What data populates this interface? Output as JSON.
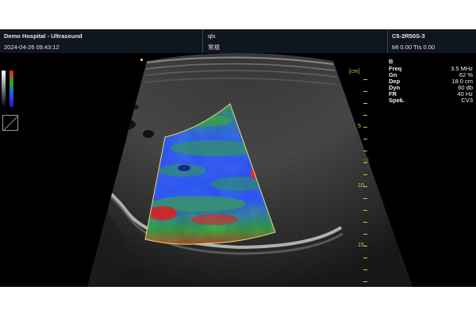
{
  "header": {
    "title": "Demo Hospital - Ultrasound",
    "datetime": "2024-04-26 09:43:12",
    "patient_id": "qlx",
    "patient_name": "常规",
    "probe": "C5-2R50S-3",
    "indices": "MI 0.00 TIs 0.00"
  },
  "params": {
    "mode": "B",
    "rows": [
      {
        "label": "Freq",
        "value": "3.5 MHz"
      },
      {
        "label": "Gn",
        "value": "62 %"
      },
      {
        "label": "Dep",
        "value": "18.0 cm"
      },
      {
        "label": "Dyn",
        "value": "60 db"
      },
      {
        "label": "FR",
        "value": "40 Hz"
      },
      {
        "label": "Spek.",
        "value": "CV3"
      }
    ]
  },
  "depth_scale": {
    "unit": "[cm]",
    "labels": [
      "5",
      "10",
      "15"
    ]
  },
  "colors": {
    "header_bg": "#0f161d",
    "scale": "#d8c24a",
    "focus_marker": "#32d232",
    "elasto_high": "#ff1a1a",
    "elasto_mid": "#22a836",
    "elasto_low": "#2a46ff"
  },
  "icons": {
    "focus": "focus-triangle-icon",
    "zoom": "zoom-box-icon"
  }
}
